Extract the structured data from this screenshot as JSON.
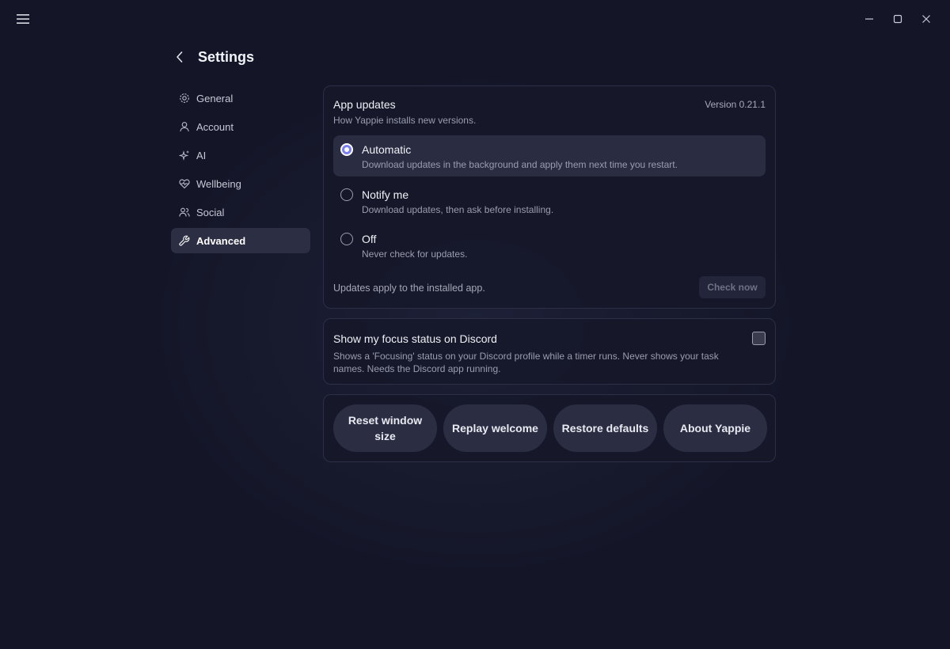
{
  "header": {
    "title": "Settings"
  },
  "sidebar": {
    "items": [
      {
        "label": "General",
        "icon": "gear-icon"
      },
      {
        "label": "Account",
        "icon": "person-icon"
      },
      {
        "label": "AI",
        "icon": "sparkles-icon"
      },
      {
        "label": "Wellbeing",
        "icon": "heart-pulse-icon"
      },
      {
        "label": "Social",
        "icon": "people-icon"
      },
      {
        "label": "Advanced",
        "icon": "wrench-icon",
        "active": true
      }
    ]
  },
  "updates": {
    "title": "App updates",
    "version": "Version 0.21.1",
    "subtitle": "How Yappie installs new versions.",
    "options": [
      {
        "label": "Automatic",
        "description": "Download updates in the background and apply them next time you restart.",
        "selected": true
      },
      {
        "label": "Notify me",
        "description": "Download updates, then ask before installing.",
        "selected": false
      },
      {
        "label": "Off",
        "description": "Never check for updates.",
        "selected": false
      }
    ],
    "footer": "Updates apply to the installed app.",
    "check_button": "Check now"
  },
  "discord": {
    "title": "Show my focus status on Discord",
    "description": "Shows a 'Focusing' status on your Discord profile while a timer runs. Never shows your task names. Needs the Discord app running.",
    "checked": false
  },
  "actions": {
    "reset_window": "Reset window size",
    "replay_welcome": "Replay welcome",
    "restore_defaults": "Restore defaults",
    "about": "About Yappie"
  },
  "colors": {
    "background": "#141628",
    "accent": "#7b7ff0",
    "selected_row": "#2a2c41"
  }
}
